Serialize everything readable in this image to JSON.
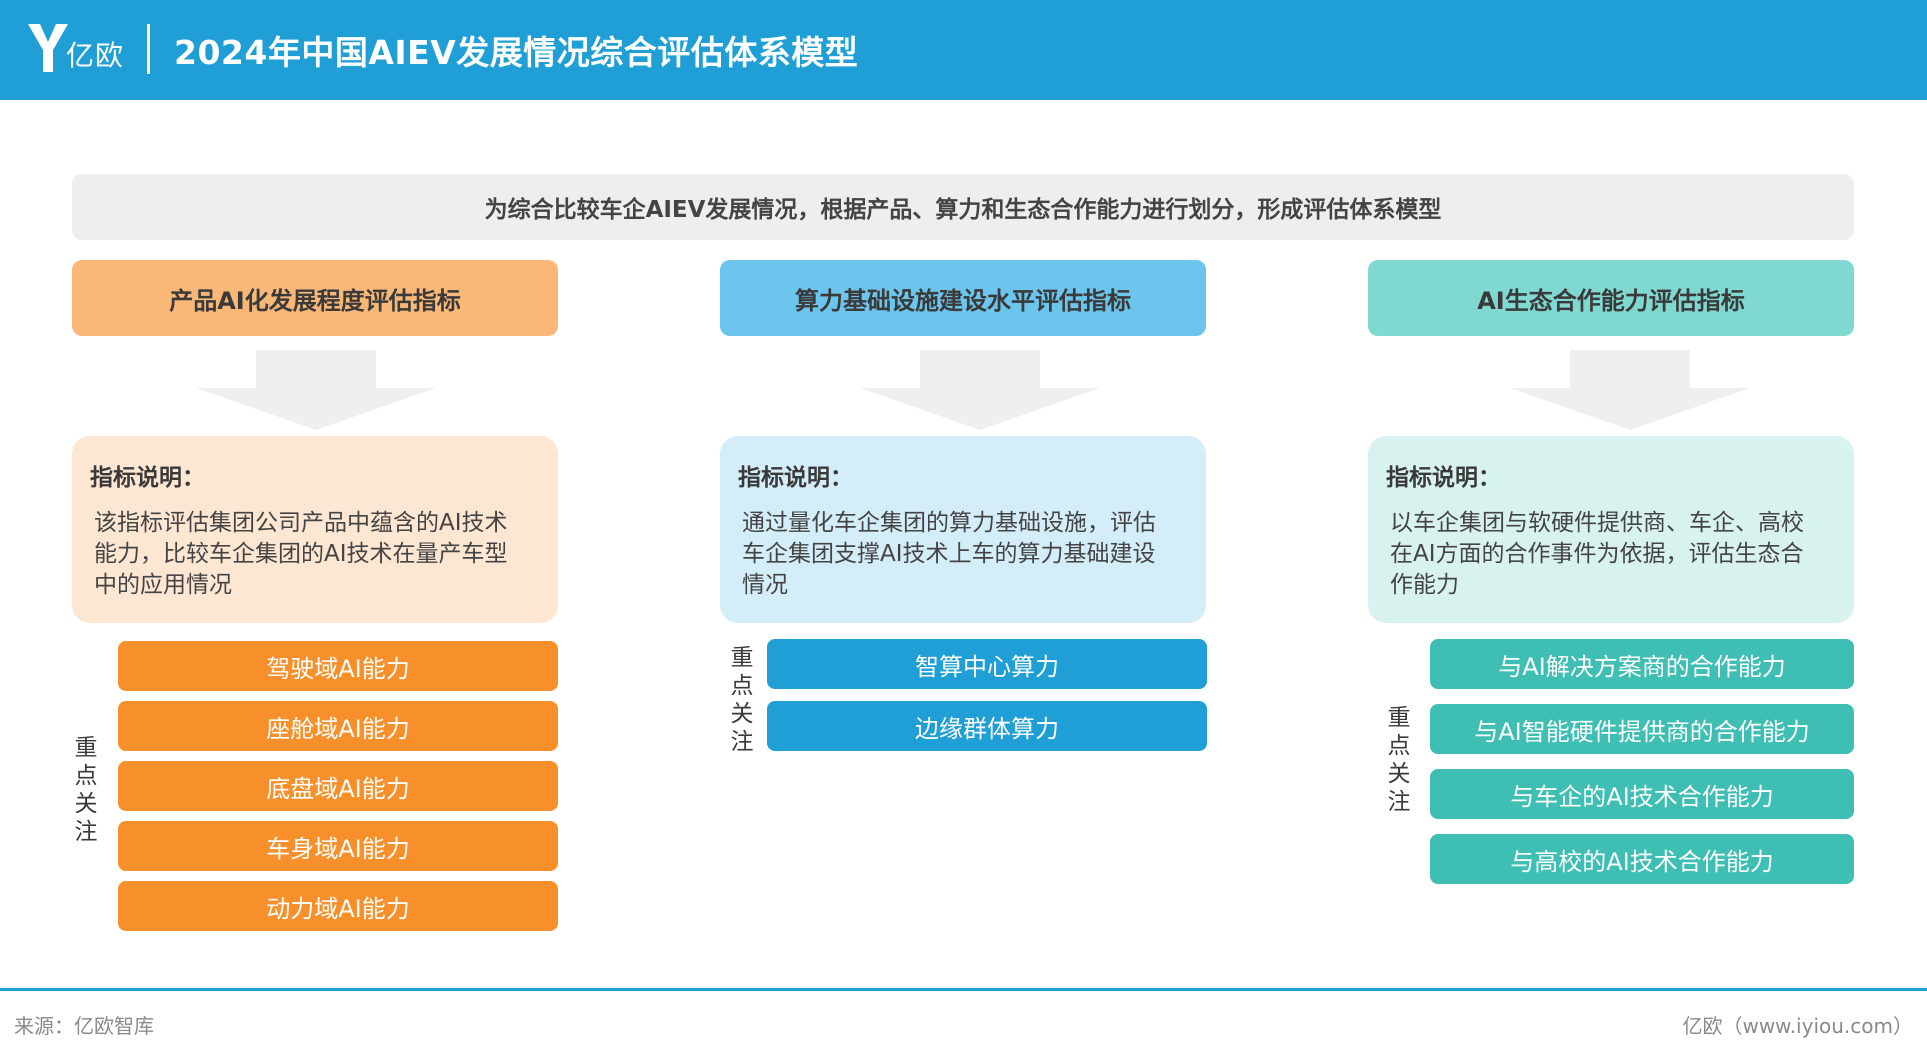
{
  "header": {
    "logo_text": "亿欧",
    "title": "2024年中国AIEV发展情况综合评估体系模型"
  },
  "intro": "为综合比较车企AIEV发展情况，根据产品、算力和生态合作能力进行划分，形成评估体系模型",
  "columns": [
    {
      "header": "产品AI化发展程度评估指标",
      "desc_title": "指标说明：",
      "desc_text": "该指标评估集团公司产品中蕴含的AI技术能力，比较车企集团的AI技术在量产车型中的应用情况",
      "focus_label": "重\n点\n关\n注",
      "items": [
        "驾驶域AI能力",
        "座舱域AI能力",
        "底盘域AI能力",
        "车身域AI能力",
        "动力域AI能力"
      ]
    },
    {
      "header": "算力基础设施建设水平评估指标",
      "desc_title": "指标说明：",
      "desc_text": "通过量化车企集团的算力基础设施，评估车企集团支撑AI技术上车的算力基础建设情况",
      "focus_label": "重\n点\n关\n注",
      "items": [
        "智算中心算力",
        "边缘群体算力"
      ]
    },
    {
      "header": "AI生态合作能力评估指标",
      "desc_title": "指标说明：",
      "desc_text": "以车企集团与软硬件提供商、车企、高校在AI方面的合作事件为依据，评估生态合作能力",
      "focus_label": "重\n点\n关\n注",
      "items": [
        "与AI解决方案商的合作能力",
        "与AI智能硬件提供商的合作能力",
        "与车企的AI技术合作能力",
        "与高校的AI技术合作能力"
      ]
    }
  ],
  "colors": {
    "brand": "#1f9fd5",
    "col1_header": "#f9b878",
    "col1_desc": "#fde6d2",
    "col1_item": "#f7902a",
    "col2_header": "#6cc5ec",
    "col2_desc": "#d3edf9",
    "col2_item": "#1f9fd5",
    "col3_header": "#7fd9d1",
    "col3_desc": "#d7f2ef",
    "col3_item": "#3fbfb4"
  },
  "footer": {
    "source": "来源：亿欧智库",
    "site": "亿欧（www.iyiou.com）"
  }
}
